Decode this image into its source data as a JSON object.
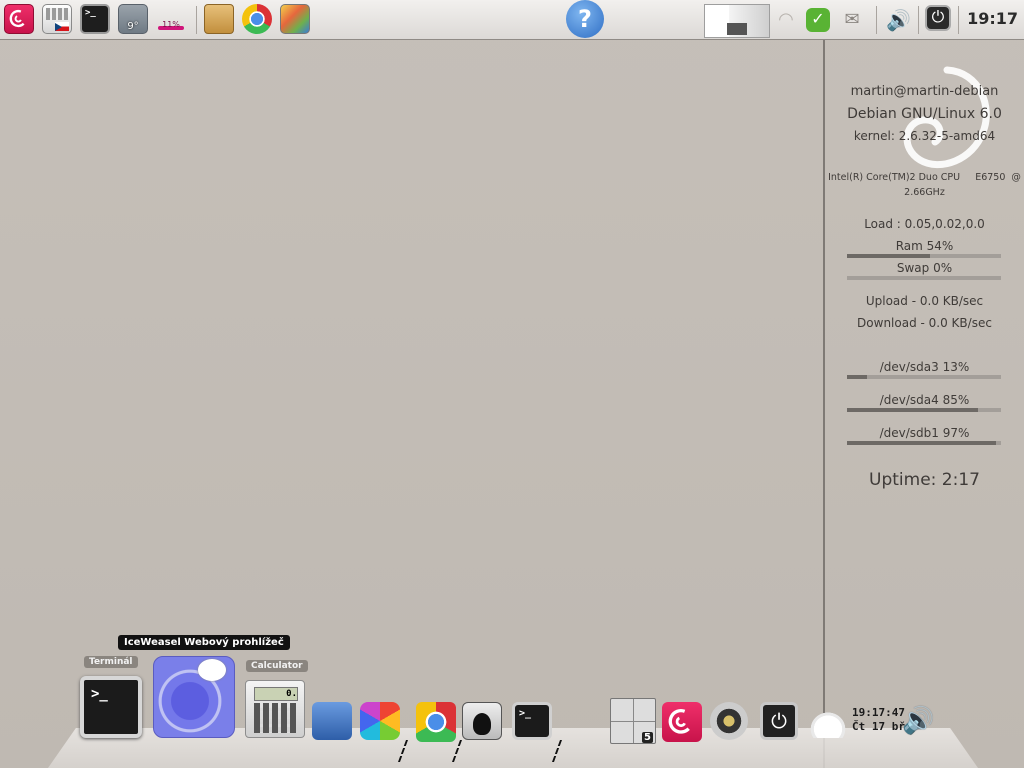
{
  "top_panel": {
    "weather_temp": "9°",
    "cpu_meter": "11%",
    "clock": "19:17"
  },
  "conky": {
    "user_host": "martin@martin-debian",
    "os": "Debian GNU/Linux 6.0",
    "kernel": "kernel: 2.6.32-5-amd64",
    "cpu_model": "Intel(R) Core(TM)2 Duo CPU     E6750  @",
    "cpu_freq": "2.66GHz",
    "load": "Load : 0.05,0.02,0.0",
    "ram": "Ram 54%",
    "ram_level": 54,
    "swap": "Swap 0%",
    "swap_level": 0,
    "upload": "Upload - 0.0 KB/sec",
    "download": "Download - 0.0 KB/sec",
    "disks": [
      {
        "label": "/dev/sda3 13%",
        "level": 13
      },
      {
        "label": "/dev/sda4 85%",
        "level": 85
      },
      {
        "label": "/dev/sdb1 97%",
        "level": 97
      }
    ],
    "uptime": "Uptime: 2:17"
  },
  "dock": {
    "tooltip": "IceWeasel Webový prohlížeč",
    "terminal_label": "Terminál",
    "calculator_label": "Calculator",
    "calc_display": "0.",
    "pager_count": "5",
    "time": "19:17:47",
    "date": "Čt 17 bře"
  },
  "colors": {
    "accent_debian": "#d70a53",
    "desktop_bg": "#c3bdb6"
  }
}
